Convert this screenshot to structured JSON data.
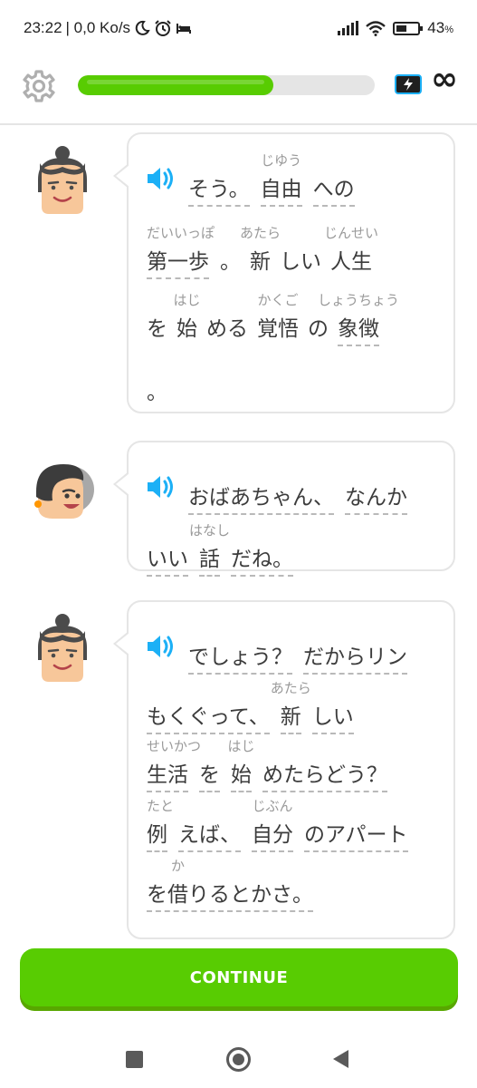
{
  "status_bar": {
    "time": "23:22",
    "network_speed": "| 0,0 Ko/s",
    "battery": "43",
    "battery_unit": "%"
  },
  "lesson": {
    "progress_fraction": 0.66,
    "hearts": "∞",
    "colors": {
      "accent": "#58cc02",
      "accent_shadow": "#58a700",
      "speaker": "#1cb0f6"
    }
  },
  "messages": [
    {
      "speaker": "woman",
      "lines": [
        {
          "tokens": [
            {
              "text": "そう。",
              "underlined": true
            },
            {
              "text": "自由",
              "reading": "じゆう",
              "underlined": true
            },
            {
              "text": "への",
              "underlined": true
            }
          ]
        },
        {
          "tokens": [
            {
              "text": "第一歩",
              "reading": "だいいっぽ",
              "underlined": true
            },
            {
              "text": "。"
            },
            {
              "text": "新",
              "reading": "あたら"
            },
            {
              "text": "しい"
            },
            {
              "text": "人生",
              "reading": "じんせい"
            }
          ]
        },
        {
          "tokens": [
            {
              "text": "を"
            },
            {
              "text": "始",
              "reading": "はじ"
            },
            {
              "text": "める"
            },
            {
              "text": "覚悟",
              "reading": "かくご"
            },
            {
              "text": "の"
            },
            {
              "text": "象徴",
              "reading": "しょうちょう",
              "underlined": true
            }
          ]
        },
        {
          "tokens": [
            {
              "text": "。"
            }
          ]
        }
      ]
    },
    {
      "speaker": "grandson",
      "lines": [
        {
          "tokens": [
            {
              "text": "おばあちゃん、",
              "underlined": true
            },
            {
              "text": "なんか",
              "underlined": true
            }
          ]
        },
        {
          "tokens": [
            {
              "text": "いい",
              "underlined": true
            },
            {
              "text": "話",
              "reading": "はなし",
              "underlined": true
            },
            {
              "text": "だね。",
              "underlined": true
            }
          ]
        }
      ]
    },
    {
      "speaker": "woman",
      "lines": [
        {
          "tokens": [
            {
              "text": "でしょう？",
              "underlined": true
            },
            {
              "text": "だからリン",
              "underlined": true
            }
          ]
        },
        {
          "tokens": [
            {
              "text": "もくぐって、",
              "underlined": true
            },
            {
              "text": "新",
              "reading": "あたら",
              "underlined": true
            },
            {
              "text": "しい",
              "underlined": true
            }
          ]
        },
        {
          "tokens": [
            {
              "text": "生活",
              "reading": "せいかつ",
              "underlined": true
            },
            {
              "text": "を",
              "underlined": true
            },
            {
              "text": "始",
              "reading": "はじ",
              "underlined": true
            },
            {
              "text": "めたらどう？",
              "underlined": true
            }
          ]
        },
        {
          "tokens": [
            {
              "text": "例",
              "reading": "たと",
              "underlined": true
            },
            {
              "text": "えば、",
              "underlined": true
            },
            {
              "text": "自分",
              "reading": "じぶん",
              "underlined": true
            },
            {
              "text": "のアパート",
              "underlined": true
            }
          ]
        },
        {
          "tokens": [
            {
              "text": "を借りるとかさ。",
              "underlined": true,
              "reading": "か",
              "reading_char_index": 1
            }
          ]
        }
      ]
    }
  ],
  "continue_label": "CONTINUE"
}
